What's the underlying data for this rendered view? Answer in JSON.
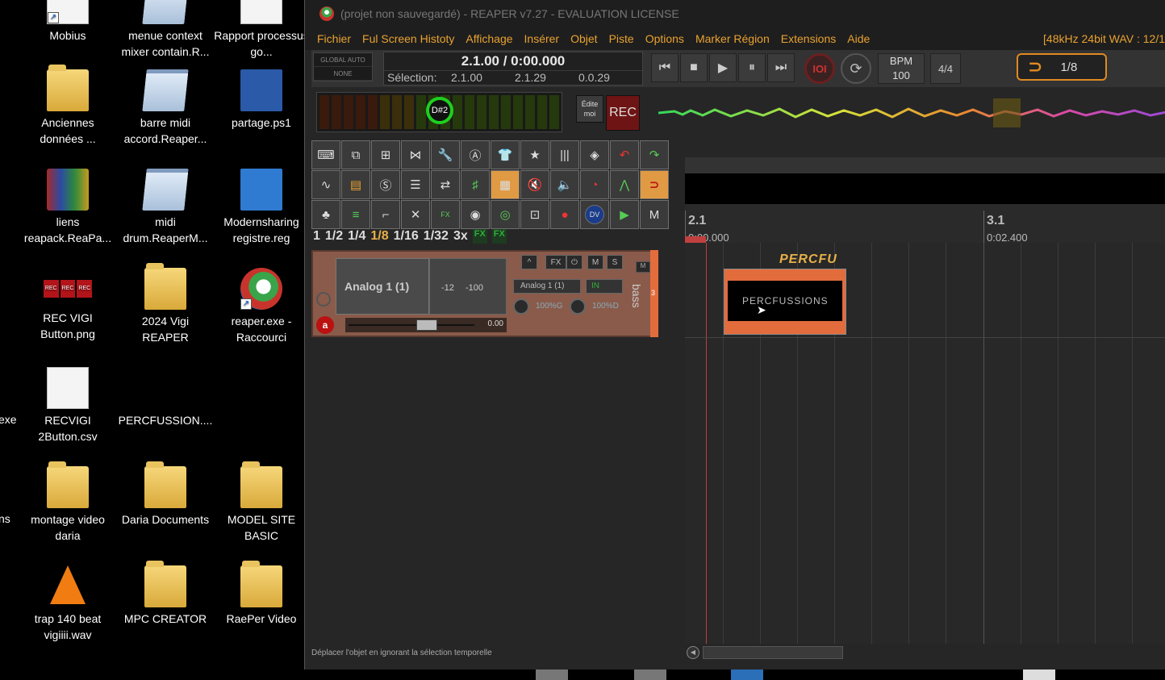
{
  "desktop": {
    "icons": [
      {
        "label": "Mobius",
        "type": "shortcut"
      },
      {
        "label": "menue context mixer contain.R...",
        "type": "notepad"
      },
      {
        "label": "Rapport processus go...",
        "type": "doc"
      },
      {
        "label": "Anciennes données ...",
        "type": "folder"
      },
      {
        "label": "barre midi accord.Reaper...",
        "type": "notepad"
      },
      {
        "label": "partage.ps1",
        "type": "powershell"
      },
      {
        "label": "liens reapack.ReaPa...",
        "type": "rar"
      },
      {
        "label": "midi drum.ReaperM...",
        "type": "notepad"
      },
      {
        "label": "Modernsharing registre.reg",
        "type": "registry"
      },
      {
        "label": "REC VIGI Button.png",
        "type": "image"
      },
      {
        "label": "2024 Vigi REAPER",
        "type": "folder"
      },
      {
        "label": "reaper.exe - Raccourci",
        "type": "reaper"
      },
      {
        "label": "RECVIGI 2Button.csv",
        "type": "csv"
      },
      {
        "label": "PERCFUSSION....",
        "type": "image"
      },
      {
        "label": "montage video daria",
        "type": "folder"
      },
      {
        "label": "Daria Documents",
        "type": "folder"
      },
      {
        "label": "MODEL SITE BASIC",
        "type": "folder"
      },
      {
        "label": "trap 140 beat vigiiii.wav",
        "type": "vlc"
      },
      {
        "label": "MPC CREATOR",
        "type": "folder"
      },
      {
        "label": "RaePer Video",
        "type": "folder"
      }
    ],
    "edge_labels": {
      "exe": "exe",
      "ns": "ns"
    },
    "rec_img_text": "REC"
  },
  "reaper": {
    "title": "(projet non sauvegardé) - REAPER v7.27 - EVALUATION LICENSE",
    "menu": [
      "Fichier",
      "Ful Screen Histoty",
      "Affichage",
      "Insérer",
      "Objet",
      "Piste",
      "Options",
      "Marker Région",
      "Extensions",
      "Aide"
    ],
    "status_format": "[48kHz 24bit WAV : 12/1",
    "global_auto": "GLOBAL AUTO",
    "global_auto_mode": "NONE",
    "position": "2.1.00 / 0:00.000",
    "selection_label": "Sélection:",
    "selection_start": "2.1.00",
    "selection_end": "2.1.29",
    "selection_length": "0.0.29",
    "bpm_label": "BPM",
    "bpm_value": "100",
    "time_signature": "4/4",
    "grid_value": "1/8",
    "key": "D#2",
    "edit_button": "Édite moi",
    "rec_button": "REC",
    "grid_divisions": [
      "1",
      "1/2",
      "1/4",
      "1/8",
      "1/16",
      "1/32",
      "3x"
    ],
    "grid_active": "1/8",
    "fx_label": "FX",
    "track": {
      "name": "Analog 1 (1)",
      "meter_db": "-12",
      "meter_peak": "-100",
      "volume": "0.00",
      "input": "Analog 1 (1)",
      "in_label": "IN",
      "fx_label": "FX",
      "mute_label": "M",
      "solo_label": "S",
      "pan_left": "100%G",
      "pan_right": "100%D",
      "track_label": "bass",
      "track_number": "3",
      "env_label": "M"
    },
    "ruler": {
      "mark1": "2.1",
      "time1": "0:00.000",
      "mark2": "3.1",
      "time2": "0:02.400"
    },
    "item": {
      "name": "PERCFUSSIONS",
      "take_label": "PERCFU"
    },
    "status_bar": "Déplacer l'objet en ignorant la sélection temporelle"
  },
  "colors": {
    "accent": "#e9a230",
    "track": "#e36c3d",
    "key_ring": "#1ed01e",
    "rec": "#6e1414"
  }
}
